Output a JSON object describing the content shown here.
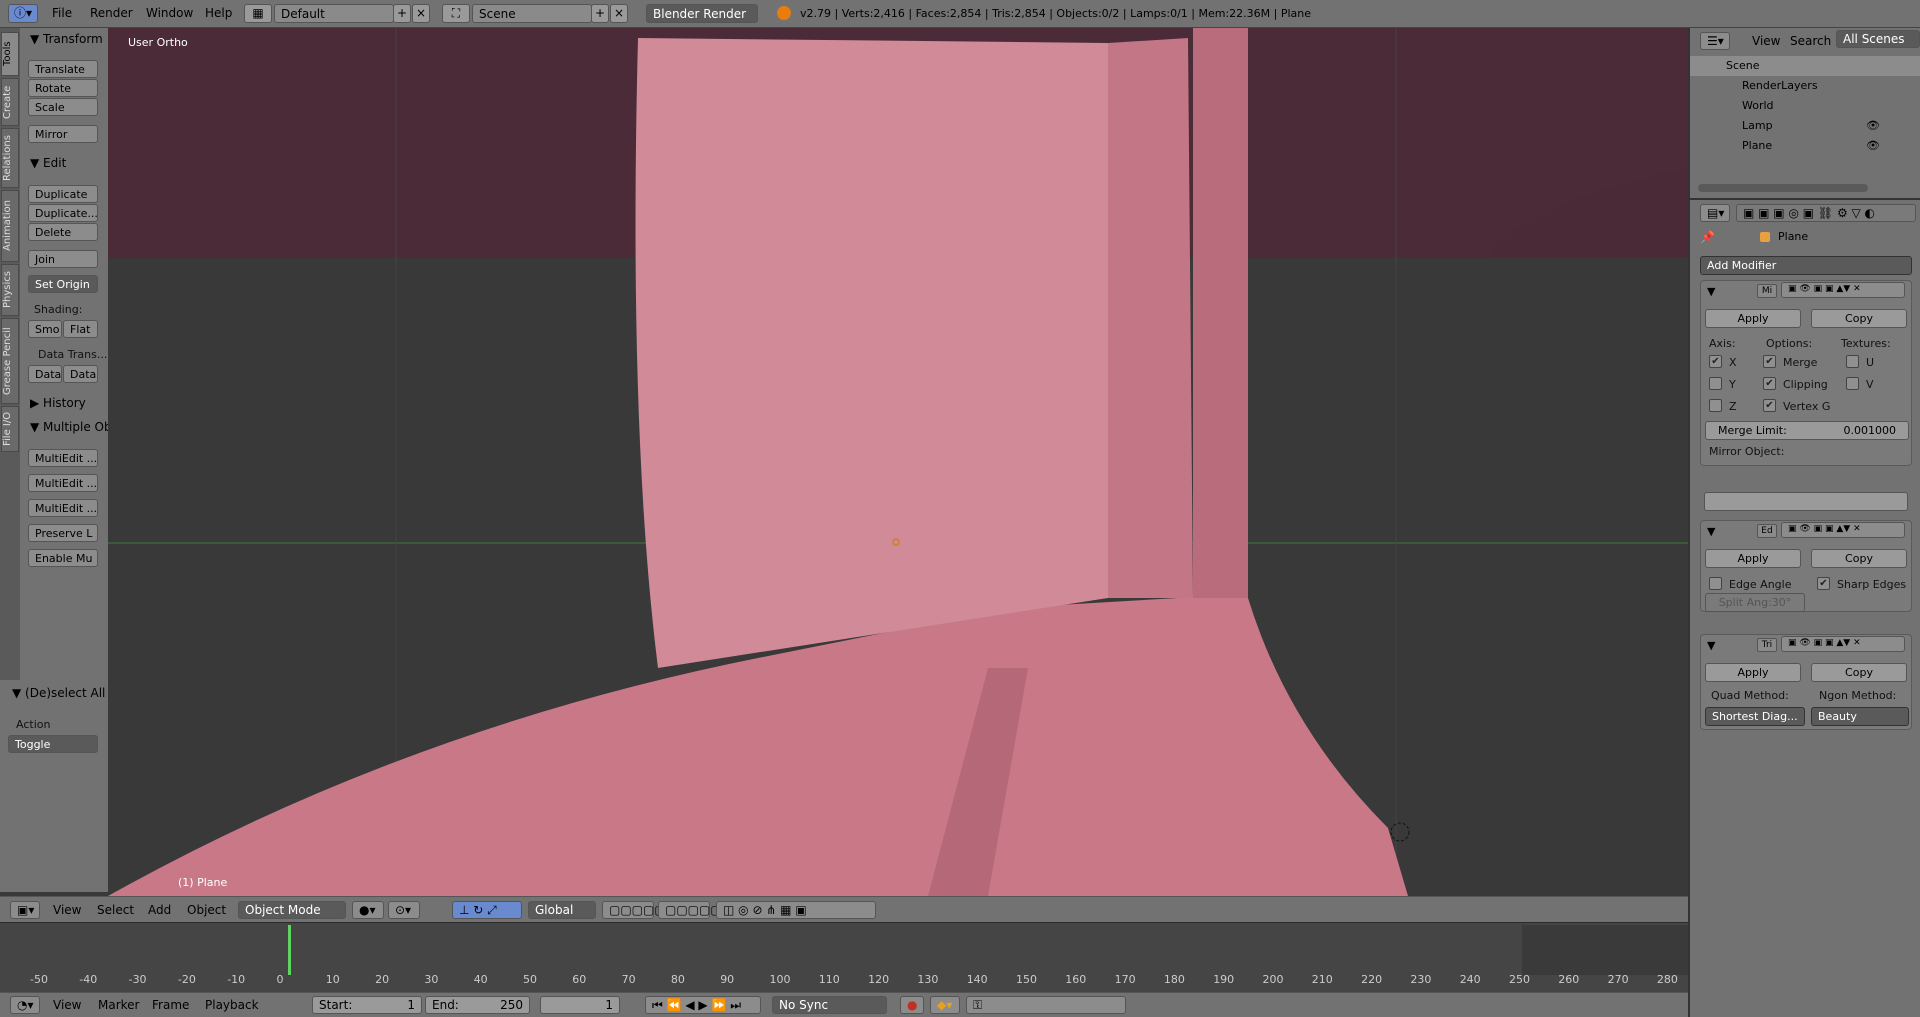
{
  "topbar": {
    "menus": [
      "File",
      "Render",
      "Window",
      "Help"
    ],
    "layout": "Default",
    "scene": "Scene",
    "engine": "Blender Render",
    "stats": "v2.79 | Verts:2,416 | Faces:2,854 | Tris:2,854 | Objects:0/2 | Lamps:0/1 | Mem:22.36M | Plane"
  },
  "tabs": [
    "Tools",
    "Create",
    "Relations",
    "Animation",
    "Physics",
    "Grease Pencil",
    "File I/O"
  ],
  "toolpanel": {
    "transform_title": "Transform",
    "translate": "Translate",
    "rotate": "Rotate",
    "scale": "Scale",
    "mirror": "Mirror",
    "edit_title": "Edit",
    "duplicate": "Duplicate",
    "duplicate_linked": "Duplicate...",
    "delete": "Delete",
    "join": "Join",
    "set_origin": "Set Origin",
    "shading_label": "Shading:",
    "smooth": "Smo",
    "flat": "Flat",
    "data_transfer_label": "Data Trans...",
    "data1": "Data",
    "data2": "Data",
    "history_title": "History",
    "multiple_title": "Multiple Ob",
    "multiedit1": "MultiEdit ...",
    "multiedit2": "MultiEdit ...",
    "multiedit3": "MultiEdit ...",
    "preserve": "Preserve L",
    "enable": "Enable Mu"
  },
  "operator": {
    "title": "(De)select All",
    "action_label": "Action",
    "action_value": "Toggle"
  },
  "viewport": {
    "view_label": "User Ortho",
    "object_label": "(1) Plane"
  },
  "vheader": {
    "view": "View",
    "select": "Select",
    "add": "Add",
    "object": "Object",
    "mode": "Object Mode",
    "orientation": "Global"
  },
  "timeline": {
    "ticks": [
      "-50",
      "-40",
      "-30",
      "-20",
      "-10",
      "0",
      "10",
      "20",
      "30",
      "40",
      "50",
      "60",
      "70",
      "80",
      "90",
      "100",
      "110",
      "120",
      "130",
      "140",
      "150",
      "160",
      "170",
      "180",
      "190",
      "200",
      "210",
      "220",
      "230",
      "240",
      "250",
      "260",
      "270",
      "280"
    ],
    "view": "View",
    "marker": "Marker",
    "frame": "Frame",
    "playback": "Playback",
    "start_label": "Start:",
    "start_value": "1",
    "end_label": "End:",
    "end_value": "250",
    "current": "1",
    "sync": "No Sync"
  },
  "outliner": {
    "view": "View",
    "search": "Search",
    "all_scenes": "All Scenes",
    "rows": [
      "Scene",
      "RenderLayers",
      "World",
      "Lamp",
      "Plane"
    ]
  },
  "props": {
    "object_name": "Plane",
    "add_modifier": "Add Modifier",
    "mod1_name": "Mi",
    "mod2_name": "Ed",
    "mod3_name": "Tri",
    "apply": "Apply",
    "copy": "Copy",
    "axis_label": "Axis:",
    "options_label": "Options:",
    "textures_label": "Textures:",
    "x": "X",
    "y": "Y",
    "z": "Z",
    "merge": "Merge",
    "clipping": "Clipping",
    "vertex_g": "Vertex G",
    "u": "U",
    "v": "V",
    "merge_limit_label": "Merge Limit:",
    "merge_limit_value": "0.001000",
    "mirror_object_label": "Mirror Object:",
    "edge_angle": "Edge Angle",
    "sharp_edges": "Sharp Edges",
    "split_angle": "Split Ang:30°",
    "quad_label": "Quad Method:",
    "ngon_label": "Ngon Method:",
    "quad_value": "Shortest Diag...",
    "ngon_value": "Beauty"
  },
  "colors": {
    "mesh": "#c9788a",
    "mesh_shadow": "#a85a6d",
    "upper_bg": "#4a2a36",
    "ui_gray": "#727272",
    "accent": "#5680c2"
  }
}
